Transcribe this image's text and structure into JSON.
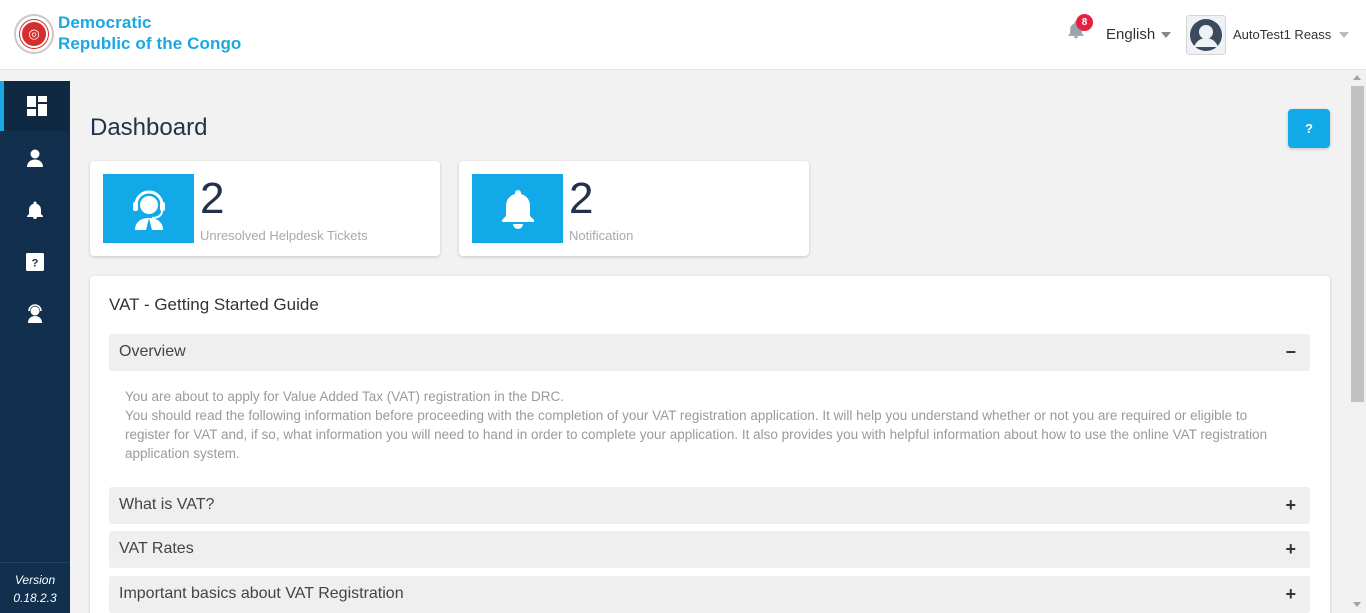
{
  "header": {
    "brand_line1": "Democratic",
    "brand_line2": "Republic of the Congo",
    "notification_count": "8",
    "language": "English",
    "user_name": "AutoTest1 Reass"
  },
  "sidebar": {
    "items": [
      {
        "icon": "dashboard-icon",
        "active": true
      },
      {
        "icon": "user-icon"
      },
      {
        "icon": "bell-icon"
      },
      {
        "icon": "help-icon"
      },
      {
        "icon": "support-agent-icon"
      }
    ],
    "version_label": "Version",
    "version_number": "0.18.2.3"
  },
  "main": {
    "title": "Dashboard",
    "help_button": "?",
    "stats": [
      {
        "value": "2",
        "label": "Unresolved Helpdesk Tickets",
        "icon": "helpdesk-agent-icon"
      },
      {
        "value": "2",
        "label": "Notification",
        "icon": "bell-icon"
      }
    ],
    "guide": {
      "title": "VAT - Getting Started Guide",
      "sections": [
        {
          "label": "Overview",
          "toggle": "−",
          "expanded": true,
          "body": [
            "You are about to apply for Value Added Tax (VAT) registration in the DRC.",
            "You should read the following information before proceeding with the completion of your VAT registration application. It will help you understand whether or not you are required or eligible to register for VAT and, if so, what information you will need to hand in order to complete your application. It also provides you with helpful information about how to use the online VAT registration application system."
          ]
        },
        {
          "label": "What is VAT?",
          "toggle": "+",
          "expanded": false
        },
        {
          "label": "VAT Rates",
          "toggle": "+",
          "expanded": false
        },
        {
          "label": "Important basics about VAT Registration",
          "toggle": "+",
          "expanded": false
        }
      ]
    }
  },
  "colors": {
    "accent": "#12a9e8",
    "sidebar": "#12304d",
    "badge": "#e8203e"
  }
}
